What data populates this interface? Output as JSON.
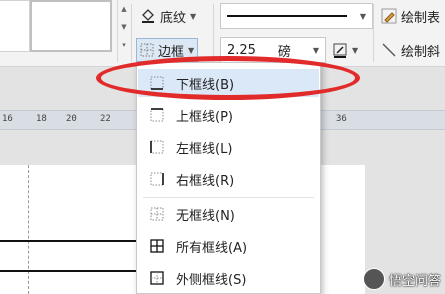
{
  "ribbon": {
    "shading_label": "底纹",
    "border_label": "边框",
    "line_weight_value": "2.25",
    "line_weight_unit": "磅",
    "draw_table_label": "绘制表",
    "draw_diagonal_label": "绘制斜"
  },
  "ruler": {
    "ticks": [
      "16",
      "18",
      "20",
      "22",
      "36"
    ]
  },
  "border_menu": {
    "items": [
      {
        "label": "下框线(B)",
        "icon": "bottom-border-icon",
        "selected": true
      },
      {
        "label": "上框线(P)",
        "icon": "top-border-icon"
      },
      {
        "label": "左框线(L)",
        "icon": "left-border-icon"
      },
      {
        "label": "右框线(R)",
        "icon": "right-border-icon"
      },
      {
        "label": "无框线(N)",
        "icon": "no-border-icon"
      },
      {
        "label": "所有框线(A)",
        "icon": "all-borders-icon"
      },
      {
        "label": "外侧框线(S)",
        "icon": "outside-borders-icon"
      }
    ]
  },
  "annotation": {
    "color": "#e12b2b"
  },
  "watermark": {
    "text": "悟空问答"
  }
}
